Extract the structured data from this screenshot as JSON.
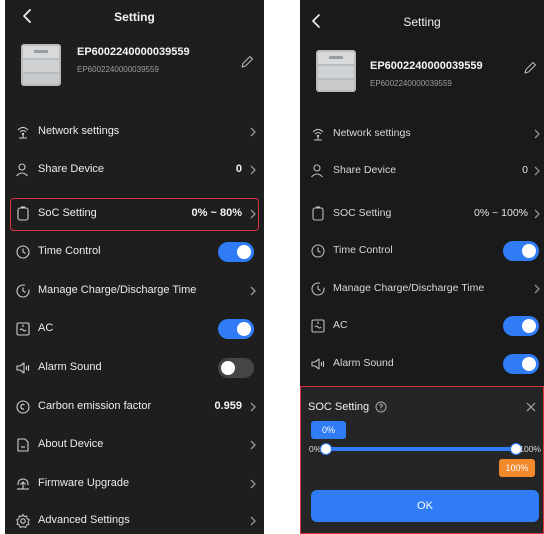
{
  "left": {
    "header": {
      "title": "Setting"
    },
    "device": {
      "name": "EP6002240000039559",
      "serial": "EP6002240000039559"
    },
    "rows": [
      {
        "label": "Network settings",
        "value": "",
        "icon": "network-icon"
      },
      {
        "label": "Share Device",
        "value": "0",
        "icon": "share-device-icon"
      },
      {
        "label": "SoC Setting",
        "value": "0% ~ 80%",
        "icon": "battery-icon"
      },
      {
        "label": "Time Control",
        "value": "",
        "icon": "clock-icon",
        "toggle": "on"
      },
      {
        "label": "Manage Charge/Discharge Time",
        "value": "",
        "icon": "schedule-icon"
      },
      {
        "label": "AC",
        "value": "",
        "icon": "ac-icon",
        "toggle": "on"
      },
      {
        "label": "Alarm Sound",
        "value": "",
        "icon": "speaker-icon",
        "toggle": "off"
      },
      {
        "label": "Carbon emission factor",
        "value": "0.959",
        "icon": "carbon-icon"
      },
      {
        "label": "About Device",
        "value": "",
        "icon": "about-icon"
      },
      {
        "label": "Firmware Upgrade",
        "value": "",
        "icon": "upgrade-icon"
      },
      {
        "label": "Advanced Settings",
        "value": "",
        "icon": "gear-icon"
      }
    ]
  },
  "right": {
    "header": {
      "title": "Setting"
    },
    "device": {
      "name": "EP6002240000039559",
      "serial": "EP6002240000039559"
    },
    "rows": [
      {
        "label": "Network settings",
        "value": "",
        "icon": "network-icon"
      },
      {
        "label": "Share Device",
        "value": "0",
        "icon": "share-device-icon"
      },
      {
        "label": "SOC Setting",
        "value": "0% ~ 100%",
        "icon": "battery-icon"
      },
      {
        "label": "Time Control",
        "value": "",
        "icon": "clock-icon",
        "toggle": "on"
      },
      {
        "label": "Manage Charge/Discharge Time",
        "value": "",
        "icon": "schedule-icon"
      },
      {
        "label": "AC",
        "value": "",
        "icon": "ac-icon",
        "toggle": "on"
      },
      {
        "label": "Alarm Sound",
        "value": "",
        "icon": "speaker-icon",
        "toggle": "on"
      }
    ],
    "soc_dialog": {
      "title": "SOC Setting",
      "min_bubble": "0%",
      "max_bubble": "100%",
      "min_label": "0%",
      "max_label": "100%",
      "range_min": 0,
      "range_max": 100,
      "ok_label": "OK"
    }
  },
  "colors": {
    "accent": "#2f7cf6",
    "highlight": "#d8343f",
    "max_bubble": "#f08a2c",
    "background": "#1e1e1e"
  }
}
